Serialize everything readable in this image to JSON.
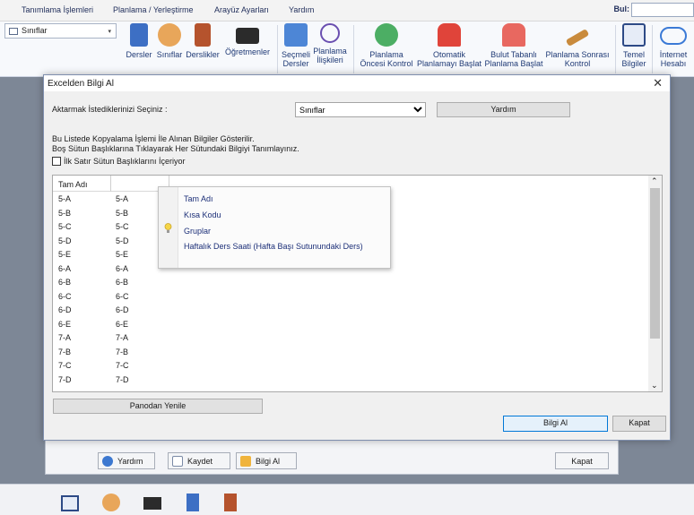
{
  "menubar": {
    "items": [
      "Tanımlama İşlemleri",
      "Planlama / Yerleştirme",
      "Arayüz Ayarları",
      "Yardım"
    ],
    "find_label": "Bul:"
  },
  "ribbon": {
    "class_combo": "Sınıflar",
    "buttons": [
      {
        "line1": "Dersler",
        "line2": "",
        "icon": "book-icon"
      },
      {
        "line1": "Sınıflar",
        "line2": "",
        "icon": "students-icon"
      },
      {
        "line1": "Derslikler",
        "line2": "",
        "icon": "door-icon"
      },
      {
        "line1": "Öğretmenler",
        "line2": "",
        "icon": "graduation-cap-icon"
      },
      {
        "line1": "Seçmeli",
        "line2": "Dersler",
        "icon": "elective-icon"
      },
      {
        "line1": "Planlama",
        "line2": "İlişkileri",
        "icon": "network-icon"
      },
      {
        "line1": "Planlama",
        "line2": "Öncesi Kontrol",
        "icon": "check-icon"
      },
      {
        "line1": "Otomatik",
        "line2": "Planlamayı Başlat",
        "icon": "auto-plan-icon"
      },
      {
        "line1": "Bulut Tabanlı",
        "line2": "Planlama Başlat",
        "icon": "cloud-plan-icon"
      },
      {
        "line1": "Planlama Sonrası",
        "line2": "Kontrol",
        "icon": "gavel-icon"
      },
      {
        "line1": "Temel",
        "line2": "Bilgiler",
        "icon": "bank-icon"
      },
      {
        "line1": "İnternet",
        "line2": "Hesabı",
        "icon": "cloud-icon"
      }
    ]
  },
  "background": {
    "help": "Yardım",
    "save": "Kaydet",
    "import": "Bilgi Al",
    "close": "Kapat"
  },
  "dialog": {
    "title": "Excelden Bilgi Al",
    "select_label": "Aktarmak İstediklerinizi Seçiniz :",
    "select_value": "Sınıflar",
    "help_button": "Yardım",
    "info_line1": "Bu Listede Kopyalama İşlemi İle Alınan Bilgiler Gösterilir.",
    "info_line2": "Boş Sütun Başlıklarına Tıklayarak Her Sütundaki Bilgiyi Tanımlayınız.",
    "checkbox_label": "İlk Satır Sütun Başlıklarını İçeriyor",
    "grid_header": "Tam Adı",
    "rows": [
      [
        "5-A",
        "5-A"
      ],
      [
        "5-B",
        "5-B"
      ],
      [
        "5-C",
        "5-C"
      ],
      [
        "5-D",
        "5-D"
      ],
      [
        "5-E",
        "5-E"
      ],
      [
        "6-A",
        "6-A"
      ],
      [
        "6-B",
        "6-B"
      ],
      [
        "6-C",
        "6-C"
      ],
      [
        "6-D",
        "6-D"
      ],
      [
        "6-E",
        "6-E"
      ],
      [
        "7-A",
        "7-A"
      ],
      [
        "7-B",
        "7-B"
      ],
      [
        "7-C",
        "7-C"
      ],
      [
        "7-D",
        "7-D"
      ]
    ],
    "popup_items": [
      "Tam Adı",
      "Kısa Kodu",
      "Gruplar",
      "Haftalık Ders Saati (Hafta Başı Sutunundaki Ders)"
    ],
    "refresh_button": "Panodan Yenile",
    "import_button": "Bilgi Al",
    "close_button": "Kapat"
  }
}
